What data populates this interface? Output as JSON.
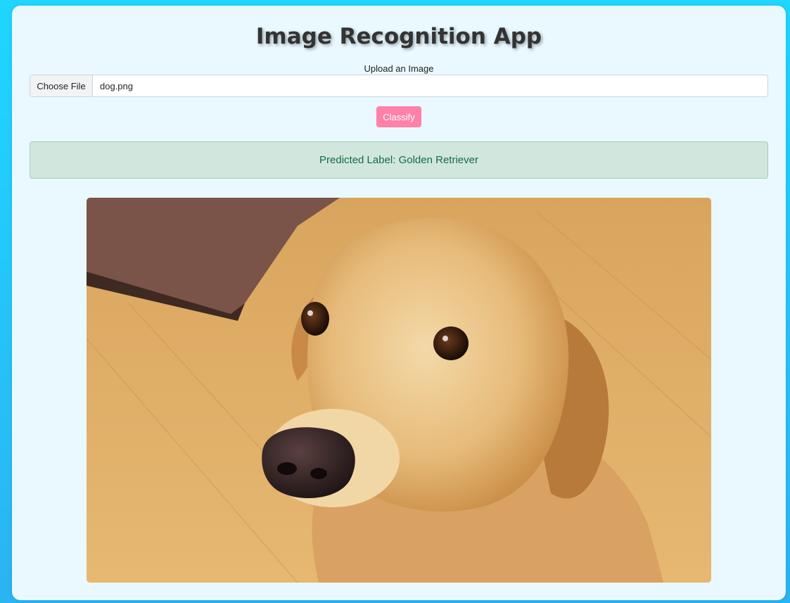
{
  "app": {
    "title": "Image Recognition App"
  },
  "upload": {
    "label": "Upload an Image",
    "button_label": "Choose File",
    "file_name": "dog.png"
  },
  "actions": {
    "classify_label": "Classify"
  },
  "result": {
    "text": "Predicted Label: Golden Retriever"
  },
  "image": {
    "subject": "golden-retriever-photo"
  },
  "colors": {
    "background": "#1fd6ff",
    "card": "#e9f9ff",
    "classify_button": "#ff80a8",
    "result_bg": "#d1e7dd",
    "result_text": "#146c43"
  }
}
